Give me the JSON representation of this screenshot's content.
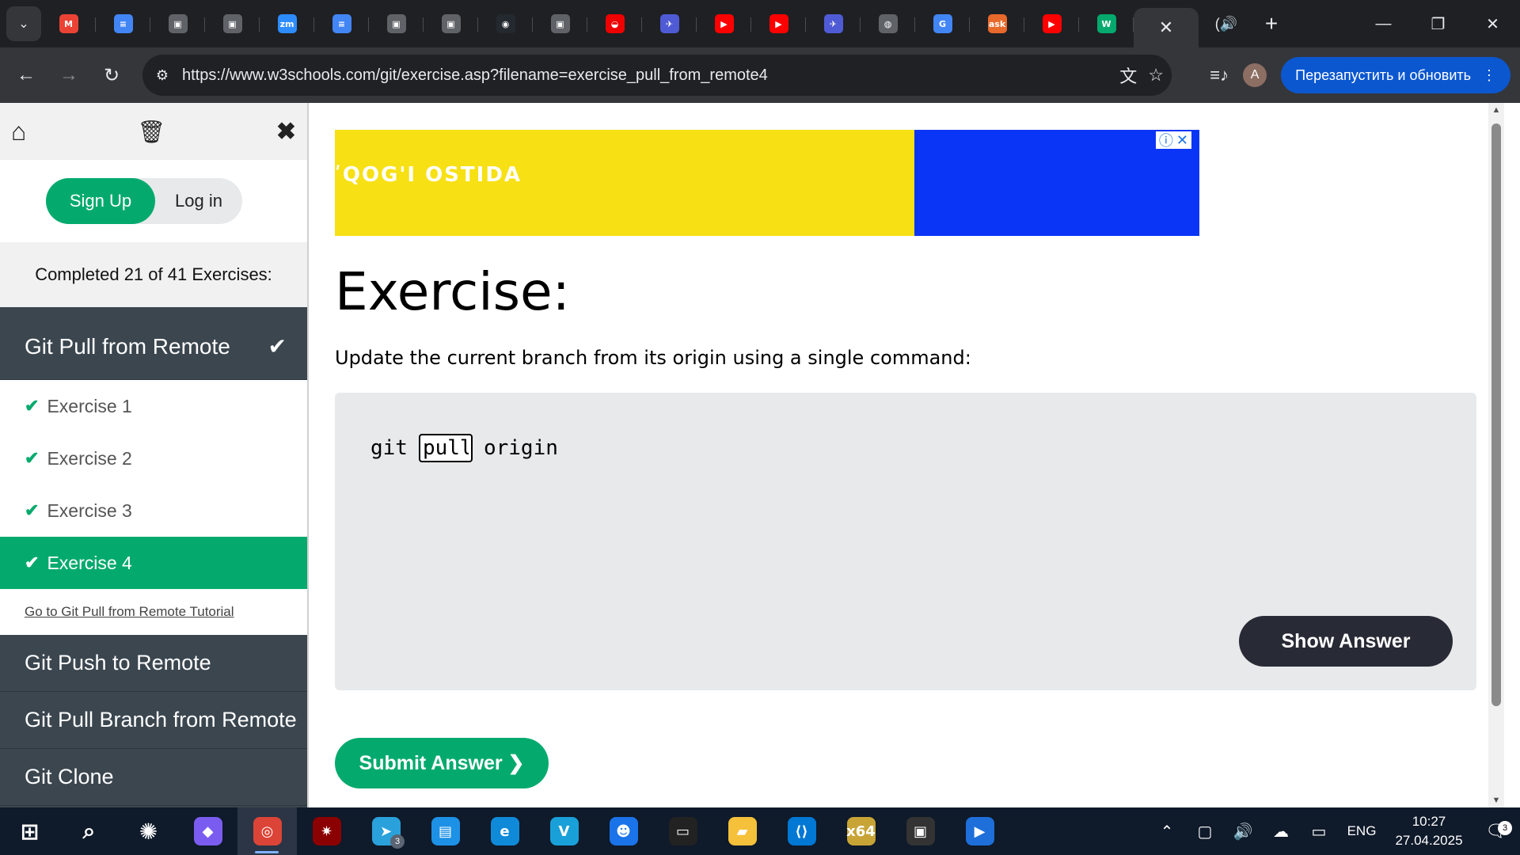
{
  "browser": {
    "tabs": [
      {
        "icon": "gmail-icon",
        "glyph": "M",
        "color": "#ea4335"
      },
      {
        "icon": "google-docs-icon",
        "glyph": "≡",
        "color": "#4285f4"
      },
      {
        "icon": "profile-page-icon",
        "glyph": "▣",
        "color": "#5f6368"
      },
      {
        "icon": "profile-page-icon",
        "glyph": "▣",
        "color": "#5f6368"
      },
      {
        "icon": "zoom-icon",
        "glyph": "zm",
        "color": "#2d8cff"
      },
      {
        "icon": "google-docs-icon",
        "glyph": "≡",
        "color": "#4285f4"
      },
      {
        "icon": "profile-page-icon",
        "glyph": "▣",
        "color": "#5f6368"
      },
      {
        "icon": "profile-page-icon",
        "glyph": "▣",
        "color": "#5f6368"
      },
      {
        "icon": "github-icon",
        "glyph": "◉",
        "color": "#24292f"
      },
      {
        "icon": "profile-page-icon",
        "glyph": "▣",
        "color": "#5f6368"
      },
      {
        "icon": "redhat-icon",
        "glyph": "◒",
        "color": "#ee0000"
      },
      {
        "icon": "bird-icon",
        "glyph": "✈",
        "color": "#4f5bd5"
      },
      {
        "icon": "youtube-icon",
        "glyph": "▶",
        "color": "#ff0000"
      },
      {
        "icon": "youtube-icon",
        "glyph": "▶",
        "color": "#ff0000"
      },
      {
        "icon": "bird-icon",
        "glyph": "✈",
        "color": "#4f5bd5"
      },
      {
        "icon": "globe-icon",
        "glyph": "◍",
        "color": "#5f6368"
      },
      {
        "icon": "google-translate-icon",
        "glyph": "G",
        "color": "#4285f4"
      },
      {
        "icon": "ask-icon",
        "glyph": "ask",
        "color": "#e8692c"
      },
      {
        "icon": "youtube-icon",
        "glyph": "▶",
        "color": "#ff0000"
      },
      {
        "icon": "w3schools-icon",
        "glyph": "W",
        "color": "#04aa6d"
      }
    ],
    "url": "https://www.w3schools.com/git/exercise.asp?filename=exercise_pull_from_remote4",
    "profile_initial": "A",
    "relaunch_label": "Перезапустить и обновить"
  },
  "sidebar": {
    "signup_label": "Sign Up",
    "login_label": "Log in",
    "progress_text": "Completed 21 of 41 Exercises:",
    "current_section": "Git Pull from Remote",
    "check_glyph": "✔",
    "exercises": [
      "Exercise 1",
      "Exercise 2",
      "Exercise 3",
      "Exercise 4"
    ],
    "tutorial_link": "Go to Git Pull from Remote Tutorial",
    "next_sections": [
      "Git Push to Remote",
      "Git Pull Branch from Remote",
      "Git Clone"
    ]
  },
  "ad": {
    "text": "ʹQOG'I OSTIDA",
    "info": "ⓘ",
    "close": "✕"
  },
  "exercise": {
    "title": "Exercise:",
    "description": "Update the current branch from its origin using a single command:",
    "code_before": "git",
    "input_value": "pull",
    "code_after": "origin",
    "show_answer_label": "Show Answer",
    "submit_label": "Submit Answer ❯"
  },
  "taskbar": {
    "apps": [
      {
        "icon": "windows-start-icon",
        "glyph": "⊞",
        "color": "transparent"
      },
      {
        "icon": "search-icon",
        "glyph": "⌕",
        "color": "transparent"
      },
      {
        "icon": "chatgpt-icon",
        "glyph": "✺",
        "color": "transparent"
      },
      {
        "icon": "copilot-icon",
        "glyph": "◆",
        "color": "#7b5cf0"
      },
      {
        "icon": "chrome-icon",
        "glyph": "◎",
        "color": "#db4437"
      },
      {
        "icon": "antivirus-icon",
        "glyph": "✷",
        "color": "#8b0000"
      },
      {
        "icon": "telegram-icon",
        "glyph": "➤",
        "color": "#2aa1da"
      },
      {
        "icon": "docker-icon",
        "glyph": "▤",
        "color": "#1d91e6"
      },
      {
        "icon": "edge-icon",
        "glyph": "e",
        "color": "#0f8ad8"
      },
      {
        "icon": "visual-paradigm-icon",
        "glyph": "V",
        "color": "#1aa0d8"
      },
      {
        "icon": "penguin-icon",
        "glyph": "☻",
        "color": "#1a73e8"
      },
      {
        "icon": "terminal-icon",
        "glyph": "▭",
        "color": "#222"
      },
      {
        "icon": "file-explorer-icon",
        "glyph": "▰",
        "color": "#f5c03a"
      },
      {
        "icon": "vscode-icon",
        "glyph": "⟨⟩",
        "color": "#0078d4"
      },
      {
        "icon": "x64-tool-icon",
        "glyph": "x64",
        "color": "#c8a436"
      },
      {
        "icon": "terminal-paint-icon",
        "glyph": "▣",
        "color": "#333"
      },
      {
        "icon": "media-player-icon",
        "glyph": "▶",
        "color": "#1e6fd9"
      }
    ],
    "telegram_badge": "3",
    "language": "ENG",
    "time": "10:27",
    "date": "27.04.2025",
    "notification_count": "3"
  }
}
